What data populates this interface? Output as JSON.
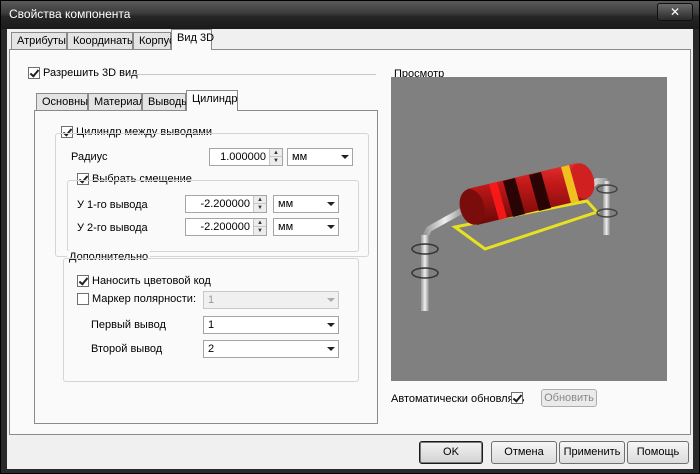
{
  "window": {
    "title": "Свойства компонента",
    "close_glyph": "✕"
  },
  "tabs": [
    "Атрибуты",
    "Координаты",
    "Корпус",
    "Вид 3D"
  ],
  "enable3d": {
    "label": "Разрешить 3D вид",
    "checked": true
  },
  "subtabs": [
    "Основные",
    "Материал",
    "Выводы",
    "Цилиндр"
  ],
  "cylinder": {
    "between_leads_label": "Цилиндр между выводами",
    "radius_label": "Радиус",
    "radius_value": "1.000000",
    "radius_unit": "мм",
    "offset_label": "Выбрать смещение",
    "lead1_label": "У 1-го вывода",
    "lead1_value": "-2.200000",
    "lead1_unit": "мм",
    "lead2_label": "У 2-го вывода",
    "lead2_value": "-2.200000",
    "lead2_unit": "мм"
  },
  "extra": {
    "group_label": "Дополнительно",
    "color_code_label": "Наносить цветовой код",
    "polarity_label": "Маркер полярности:",
    "polarity_value": "1",
    "first_lead_label": "Первый вывод",
    "first_lead_value": "1",
    "second_lead_label": "Второй вывод",
    "second_lead_value": "2"
  },
  "preview": {
    "label": "Просмотр",
    "auto_update_label": "Автоматически обновлять",
    "refresh_label": "Обновить",
    "bg_color": "#808080",
    "body_color": "#b01818"
  },
  "buttons": {
    "ok": "OK",
    "cancel": "Отмена",
    "apply": "Применить",
    "help": "Помощь"
  }
}
